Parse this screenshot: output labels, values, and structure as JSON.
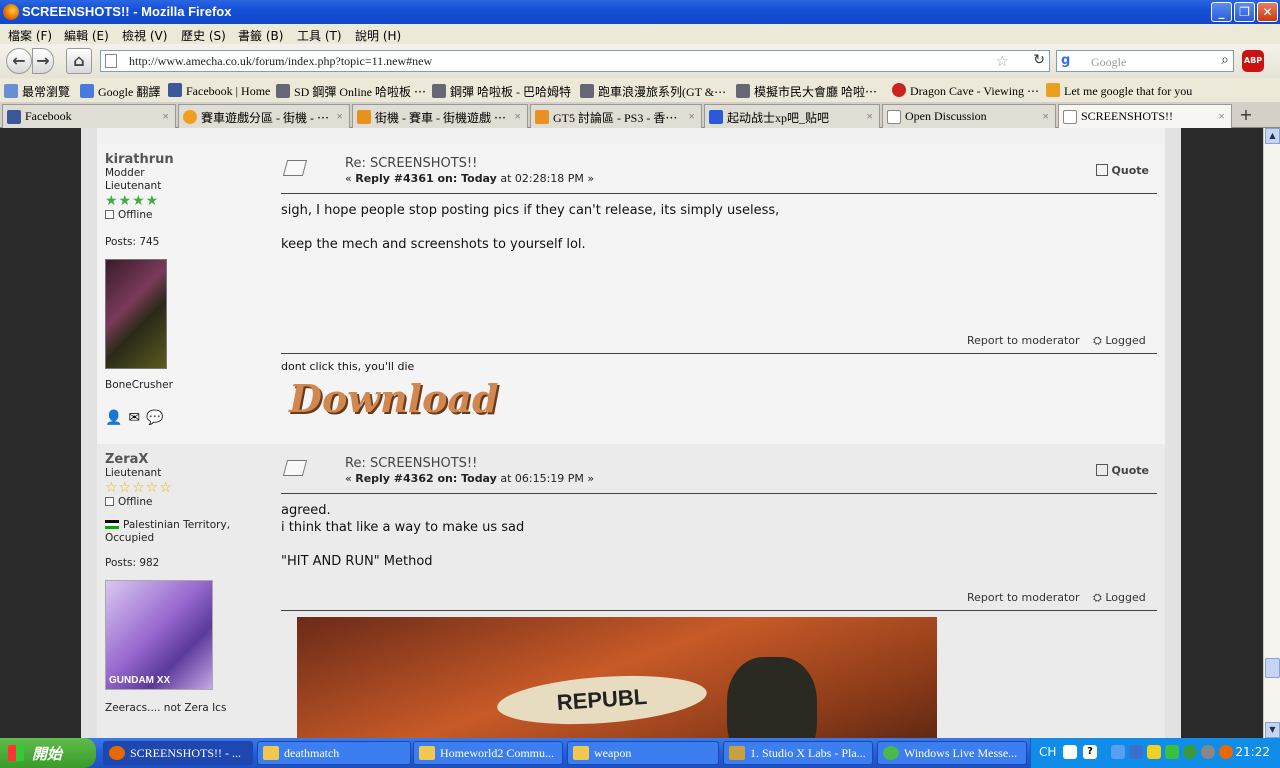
{
  "window": {
    "title": "SCREENSHOTS!! - Mozilla Firefox"
  },
  "menu": [
    "檔案 (F)",
    "編輯 (E)",
    "檢視 (V)",
    "歷史 (S)",
    "書籤 (B)",
    "工具 (T)",
    "說明 (H)"
  ],
  "nav": {
    "url": "http://www.amecha.co.uk/forum/index.php?topic=11.new#new",
    "search_placeholder": "Google",
    "search_engine_label": "g",
    "adblock_label": "ABP"
  },
  "bookmarks": [
    "最常瀏覽",
    "Google 翻譯",
    "Facebook | Home",
    "SD 鋼彈 Online 哈啦板 ⋯",
    "鋼彈 哈啦板 - 巴哈姆特",
    "跑車浪漫旅系列(GT &⋯",
    "模擬市民大會廳 哈啦⋯",
    "Dragon Cave - Viewing ⋯",
    "Let me google that for you"
  ],
  "tabs": [
    "Facebook",
    "賽車遊戲分區 - 街機 - ⋯",
    "街機 - 賽車 - 街機遊戲 ⋯",
    "GT5 討論區 - PS3 - 香⋯",
    "起动战士xp吧_贴吧",
    "Open Discussion",
    "SCREENSHOTS!!"
  ],
  "posts": [
    {
      "name": "kirathrun",
      "group": "Modder",
      "rank": "Lieutenant",
      "stars": "★★★★",
      "status": "Offline",
      "posts": "Posts: 745",
      "personal_text": "BoneCrusher",
      "subject": "Re: SCREENSHOTS!!",
      "reply_prefix": "« ",
      "reply_bold": "Reply #4361 on: Today",
      "reply_time": " at 02:28:18 PM »",
      "quote": "Quote",
      "body": "sigh, I hope people stop posting pics if they can't release, its simply useless,\n\nkeep the mech and screenshots to yourself lol.",
      "report": "Report to moderator",
      "logged": "Logged",
      "signature": "dont click this, you'll die",
      "sig_image_text": "Download"
    },
    {
      "name": "ZeraX",
      "rank": "Lieutenant",
      "stars": "☆☆☆☆☆",
      "status": "Offline",
      "location": "Palestinian Territory, Occupied",
      "posts": "Posts: 982",
      "avatar_caption": "GUNDAM XX",
      "personal_text": "Zeeracs.... not Zera Ics",
      "subject": "Re: SCREENSHOTS!!",
      "reply_prefix": "« ",
      "reply_bold": "Reply #4362 on: Today",
      "reply_time": " at 06:15:19 PM »",
      "quote": "Quote",
      "body": "agreed.\ni think that like a way to make us sad\n\n\"HIT AND RUN\" Method",
      "report": "Report to moderator",
      "logged": "Logged",
      "image_text": "REPUBL"
    }
  ],
  "taskbar": {
    "start": "開始",
    "tasks": [
      "SCREENSHOTS!! - ...",
      "deathmatch",
      "Homeworld2 Commu...",
      "weapon",
      "1. Studio X Labs - Pla...",
      "Windows Live Messe..."
    ],
    "lang": "CH",
    "time": "21:22"
  }
}
